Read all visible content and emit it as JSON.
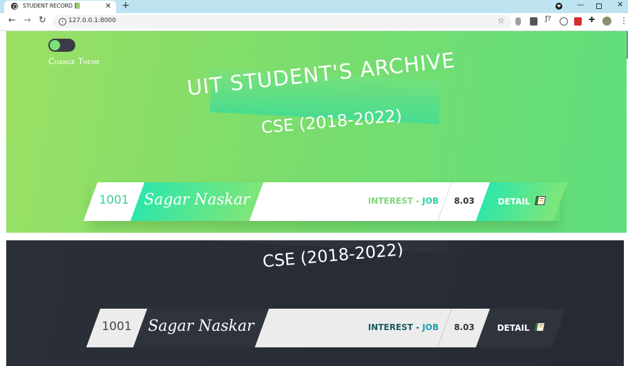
{
  "browser": {
    "tab_title": "STUDENT RECORD 📗",
    "tab_close": "✕",
    "new_tab": "+",
    "url": "127.0.0.1:8000",
    "back": "←",
    "forward": "→",
    "reload": "↻",
    "bookmark": "☆",
    "menu": "⋮",
    "minimize": "—",
    "close": "✕"
  },
  "theme_toggle": {
    "label": "Change Theme",
    "state": "light"
  },
  "hero": {
    "title": "UIT STUDENT'S ARCHIVE",
    "subtitle": "CSE (2018-2022)"
  },
  "students": [
    {
      "id": "1001",
      "name": "Sagar Naskar",
      "interest_prefix": "INTEREST - ",
      "interest": "JOB",
      "cgpa": "8.03",
      "detail_label": "DETAIL"
    }
  ],
  "dark_view": {
    "subtitle": "CSE (2018-2022)"
  },
  "colors": {
    "accent_green": "#2ee6a8",
    "light_bg": "#7bdd6c",
    "dark_bg": "#282c34",
    "interest_light": "#7fd67a",
    "interest_dark": "#1c5a63"
  }
}
